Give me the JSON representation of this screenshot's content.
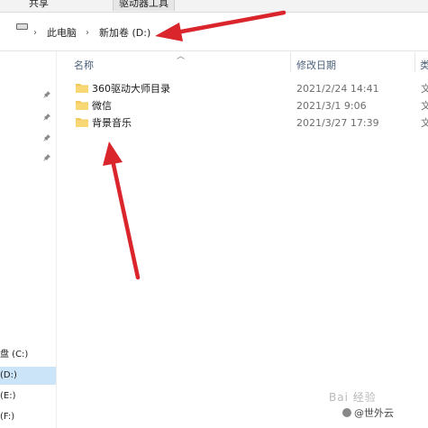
{
  "ribbon": {
    "share_tab": "共享",
    "drive_tools_tab": "驱动器工具"
  },
  "address_bar": {
    "segments": [
      "此电脑",
      "新加卷 (D:)"
    ],
    "separator": "›"
  },
  "columns": {
    "name": "名称",
    "modified": "修改日期",
    "type": "类"
  },
  "files": [
    {
      "name": "360驱动大师目录",
      "modified": "2021/2/24 14:41",
      "type": "文"
    },
    {
      "name": "微信",
      "modified": "2021/3/1 9:06",
      "type": "文"
    },
    {
      "name": "背景音乐",
      "modified": "2021/3/27 17:39",
      "type": "文"
    }
  ],
  "sidebar": {
    "items": [
      {
        "label": "盘 (C:)"
      },
      {
        "label": "(D:)"
      },
      {
        "label": "(E:)"
      },
      {
        "label": "(F:)"
      }
    ],
    "selected_index": 1
  },
  "watermark": {
    "text": "Bai 经验",
    "credit": "@世外云"
  },
  "colors": {
    "annotation_arrow": "#d9252b",
    "folder": "#f4c95d",
    "selection": "#cce4f7"
  }
}
